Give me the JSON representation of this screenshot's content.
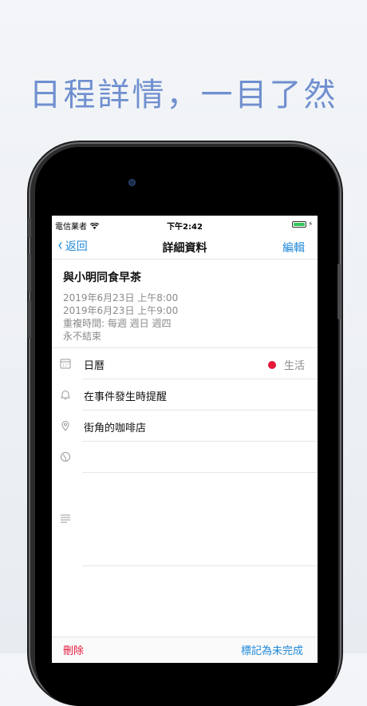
{
  "headline": "日程詳情，一目了然",
  "status": {
    "carrier": "電信業者",
    "time": "下午2:42"
  },
  "nav": {
    "back_label": "返回",
    "title": "詳細資料",
    "edit_label": "編輯"
  },
  "event": {
    "title": "與小明同食早茶",
    "start": "2019年6月23日 上午8:00",
    "end": "2019年6月23日 上午9:00",
    "repeat": "重複時間: 每週 週日 週四",
    "end_repeat": "永不結束"
  },
  "rows": {
    "calendar": {
      "label": "日曆",
      "value": "生活",
      "dot_color": "#e6173a",
      "icon": "calendar-icon"
    },
    "alert": {
      "label": "在事件發生時提醒",
      "icon": "bell-icon"
    },
    "location": {
      "label": "街角的咖啡店",
      "icon": "location-pin-icon"
    },
    "timezone": {
      "label": "",
      "icon": "globe-icon"
    },
    "notes": {
      "label": "",
      "icon": "notes-icon"
    }
  },
  "bottom": {
    "delete_label": "刪除",
    "mark_label": "標記為未完成"
  },
  "colors": {
    "accent": "#1e88d9",
    "danger": "#e6173a",
    "headline": "#6f8fcf"
  }
}
